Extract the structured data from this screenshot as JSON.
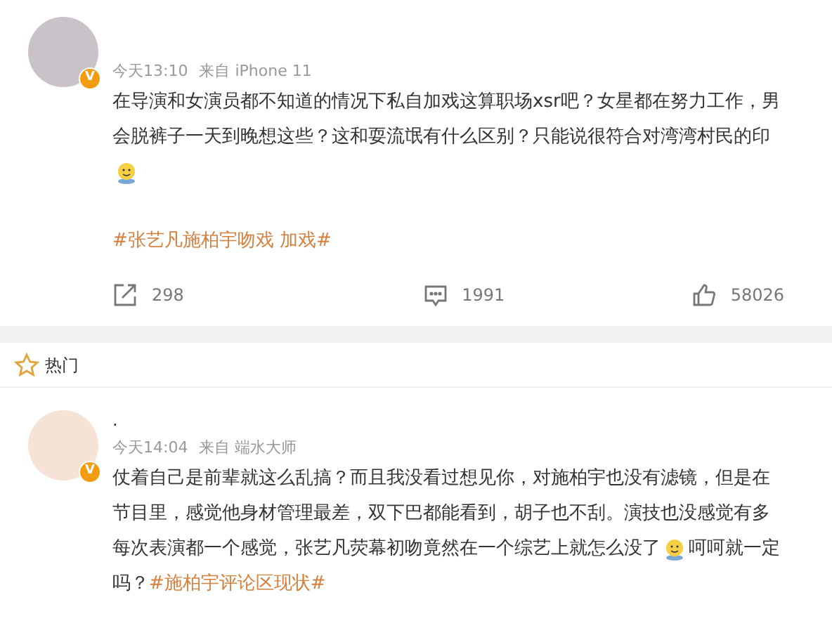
{
  "comments": [
    {
      "badge": "V",
      "time": "今天13:10",
      "source": "来自 iPhone 11",
      "lines": [
        [
          {
            "kind": "text",
            "text": "在导演和女演员都不知道的情况下私自加戏这算职场xsr吧？女星都在努力工作，男"
          }
        ],
        [
          {
            "kind": "text",
            "text": "会脱裤子一天到晚想这些？这和耍流氓有什么区别？只能说很符合对湾湾村民的印"
          }
        ],
        [
          {
            "kind": "emoji"
          }
        ],
        [
          {
            "kind": "hashtag",
            "text": "#张艺凡施柏宇吻戏 加戏#"
          }
        ]
      ],
      "actions": [
        {
          "kind": "share",
          "count": "298"
        },
        {
          "kind": "comment",
          "count": "1991"
        },
        {
          "kind": "like",
          "count": "58026"
        }
      ]
    },
    {
      "section": "热门"
    },
    {
      "badge": "V",
      "name": ".",
      "time": "今天14:04",
      "source": "来自 端水大师",
      "lines": [
        [
          {
            "kind": "text",
            "text": "仗着自己是前辈就这么乱搞？而且我没看过想见你，对施柏宇也没有滤镜，但是在"
          }
        ],
        [
          {
            "kind": "text",
            "text": "节目里，感觉他身材管理最差，双下巴都能看到，胡子也不刮。演技也没感觉有多"
          }
        ],
        [
          {
            "kind": "text",
            "text": "每次表演都一个感觉，张艺凡荧幕初吻竟然在一个综艺上就怎么没了"
          },
          {
            "kind": "emoji"
          },
          {
            "kind": "text",
            "text": "呵呵就一定"
          }
        ],
        [
          {
            "kind": "text",
            "text": "吗？"
          },
          {
            "kind": "hashtag",
            "text": "#施柏宇评论区现状#"
          }
        ]
      ]
    }
  ]
}
